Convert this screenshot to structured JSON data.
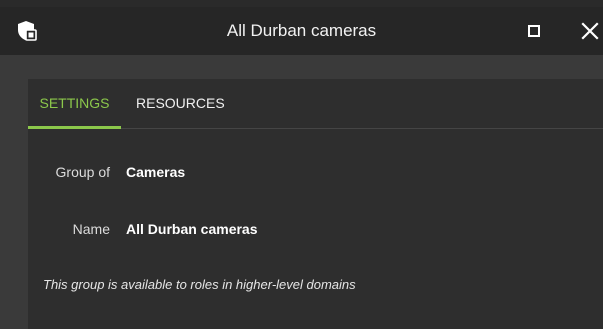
{
  "window": {
    "title": "All Durban cameras",
    "app_icon": "shield-camera-icon",
    "maximize_icon": "maximize-icon",
    "close_icon": "close-icon"
  },
  "tabs": [
    {
      "label": "SETTINGS",
      "active": true
    },
    {
      "label": "RESOURCES",
      "active": false
    }
  ],
  "fields": {
    "group_of": {
      "label": "Group of",
      "value": "Cameras"
    },
    "name": {
      "label": "Name",
      "value": "All Durban cameras"
    }
  },
  "note": "This group is available to roles in higher-level domains",
  "colors": {
    "accent": "#8cc84b",
    "titlebar": "#262626",
    "panel": "#2e2e2e",
    "background": "#3a3a3a"
  }
}
